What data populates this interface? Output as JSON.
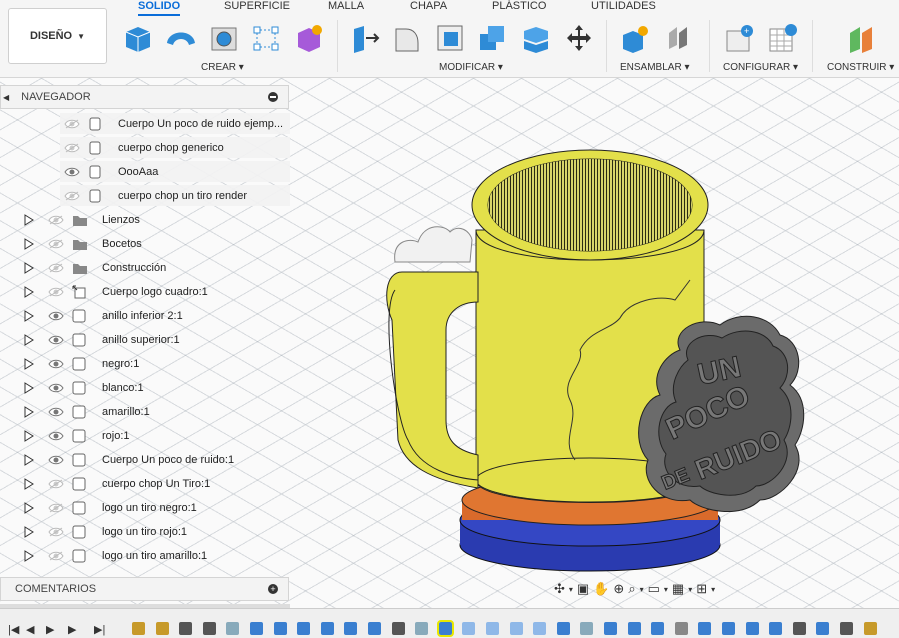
{
  "toolbar": {
    "design_label": "DISEÑO",
    "tabs": [
      "SOLIDO",
      "SUPERFICIE",
      "MALLA",
      "CHAPA",
      "PLÁSTICO",
      "UTILIDADES"
    ],
    "active_tab": "SOLIDO",
    "groups": [
      "CREAR",
      "MODIFICAR",
      "ENSAMBLAR",
      "CONFIGURAR",
      "CONSTRUIR"
    ]
  },
  "navigator": {
    "title": "NAVEGADOR",
    "items": [
      {
        "label": "Cuerpo Un poco de ruido ejemp...",
        "visible": false,
        "type": "body",
        "expandable": false
      },
      {
        "label": "cuerpo chop generico",
        "visible": false,
        "type": "body",
        "expandable": false
      },
      {
        "label": "OooAaa",
        "visible": true,
        "type": "body",
        "expandable": false
      },
      {
        "label": "cuerpo chop un tiro render",
        "visible": false,
        "type": "body",
        "expandable": false
      },
      {
        "label": "Lienzos",
        "visible": false,
        "type": "folder",
        "expandable": true
      },
      {
        "label": "Bocetos",
        "visible": false,
        "type": "folder",
        "expandable": true
      },
      {
        "label": "Construcción",
        "visible": false,
        "type": "folder",
        "expandable": true
      },
      {
        "label": "Cuerpo logo cuadro:1",
        "visible": false,
        "type": "component-link",
        "expandable": true
      },
      {
        "label": "anillo inferior 2:1",
        "visible": true,
        "type": "component",
        "expandable": true
      },
      {
        "label": "anillo superior:1",
        "visible": true,
        "type": "component",
        "expandable": true
      },
      {
        "label": "negro:1",
        "visible": true,
        "type": "component",
        "expandable": true
      },
      {
        "label": "blanco:1",
        "visible": true,
        "type": "component",
        "expandable": true
      },
      {
        "label": "amarillo:1",
        "visible": true,
        "type": "component",
        "expandable": true
      },
      {
        "label": "rojo:1",
        "visible": true,
        "type": "component",
        "expandable": true
      },
      {
        "label": "Cuerpo Un poco de ruido:1",
        "visible": true,
        "type": "component",
        "expandable": true
      },
      {
        "label": "cuerpo chop Un Tiro:1",
        "visible": false,
        "type": "component",
        "expandable": true
      },
      {
        "label": "logo un tiro negro:1",
        "visible": false,
        "type": "component",
        "expandable": true
      },
      {
        "label": "logo un tiro rojo:1",
        "visible": false,
        "type": "component",
        "expandable": true
      },
      {
        "label": "logo un tiro amarillo:1",
        "visible": false,
        "type": "component",
        "expandable": true
      }
    ]
  },
  "comments": {
    "title": "COMENTARIOS"
  },
  "model": {
    "logo_text": [
      "UN",
      "POCO",
      "DE",
      "RUIDO"
    ],
    "colors": {
      "mug": "#e3e04a",
      "orange": "#d96a2b",
      "blue": "#2a3bb0",
      "logo": "#6b6b6b",
      "accent": "#0a6dd9"
    }
  }
}
